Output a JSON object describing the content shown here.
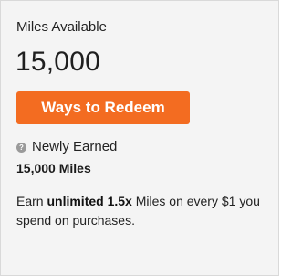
{
  "miles": {
    "label": "Miles Available",
    "value": "15,000"
  },
  "redeem": {
    "label": "Ways to Redeem",
    "color": "#f36c21"
  },
  "earned": {
    "icon": "question-circle-icon",
    "label": "Newly Earned",
    "value": "15,000 Miles"
  },
  "promo": {
    "prefix": "Earn ",
    "highlight": "unlimited 1.5x",
    "suffix": " Miles on every $1 you spend on purchases."
  }
}
